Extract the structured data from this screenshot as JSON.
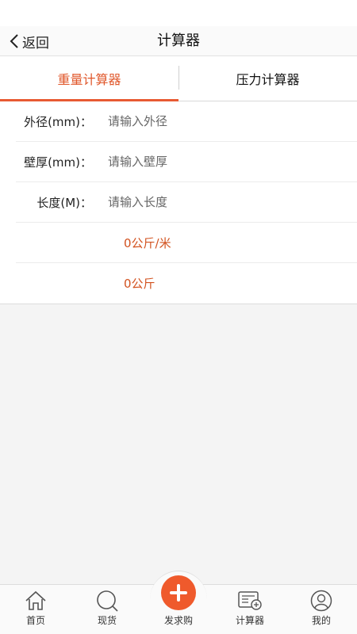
{
  "nav": {
    "back_label": "返回",
    "title": "计算器"
  },
  "tabs": [
    {
      "label": "重量计算器",
      "active": true
    },
    {
      "label": "压力计算器",
      "active": false
    }
  ],
  "form": {
    "outer_diameter": {
      "label": "外径(mm)：",
      "placeholder": "请输入外径",
      "value": ""
    },
    "wall_thickness": {
      "label": "壁厚(mm)：",
      "placeholder": "请输入壁厚",
      "value": ""
    },
    "length": {
      "label": "长度(M)：",
      "placeholder": "请输入长度",
      "value": ""
    },
    "result_per_meter": "0公斤/米",
    "result_total": "0公斤"
  },
  "colors": {
    "accent": "#e85a33",
    "result_text": "#d2521f"
  },
  "tabbar": {
    "items": [
      {
        "label": "首页",
        "icon": "home-icon"
      },
      {
        "label": "现货",
        "icon": "search-icon"
      },
      {
        "label": "发求购",
        "icon": "plus-icon"
      },
      {
        "label": "计算器",
        "icon": "calculator-icon"
      },
      {
        "label": "我的",
        "icon": "user-icon"
      }
    ]
  }
}
